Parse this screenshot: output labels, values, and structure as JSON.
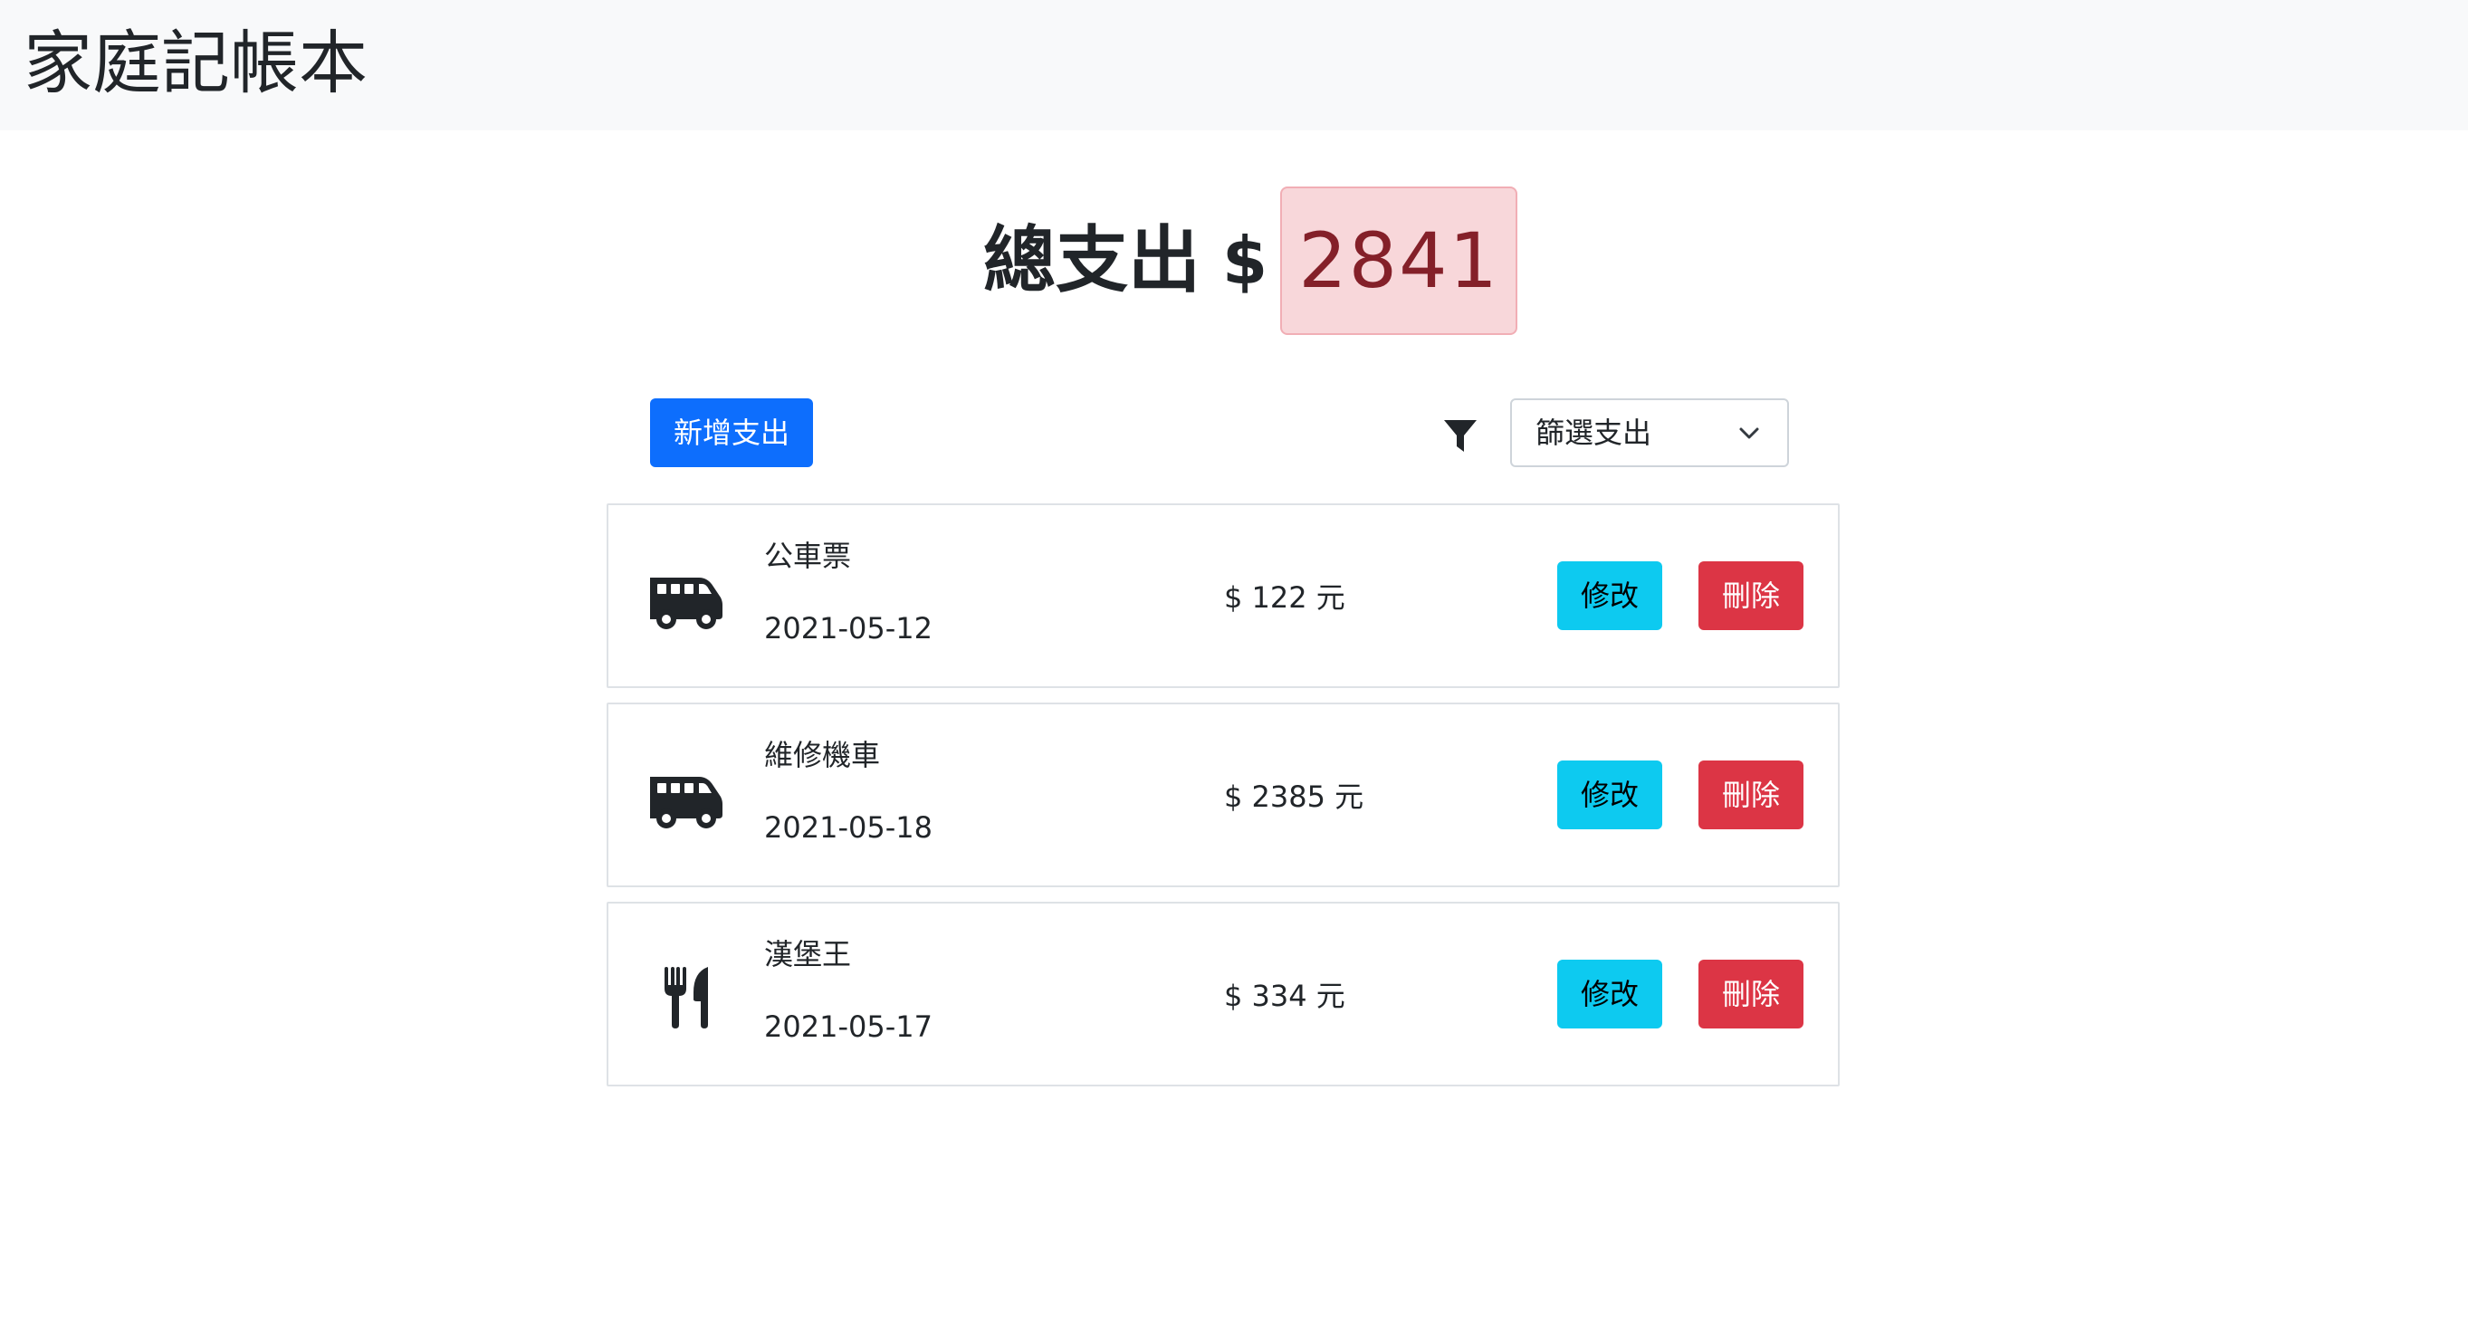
{
  "app": {
    "title": "家庭記帳本"
  },
  "summary": {
    "label": "總支出",
    "currency": "$",
    "total": "2841"
  },
  "toolbar": {
    "add_label": "新增支出",
    "filter_icon": "filter-icon",
    "filter_selected": "篩選支出"
  },
  "expenses": [
    {
      "icon": "van-icon",
      "name": "公車票",
      "date": "2021-05-12",
      "amount": "$ 122 元",
      "edit_label": "修改",
      "delete_label": "刪除"
    },
    {
      "icon": "van-icon",
      "name": "維修機車",
      "date": "2021-05-18",
      "amount": "$ 2385 元",
      "edit_label": "修改",
      "delete_label": "刪除"
    },
    {
      "icon": "utensils-icon",
      "name": "漢堡王",
      "date": "2021-05-17",
      "amount": "$ 334 元",
      "edit_label": "修改",
      "delete_label": "刪除"
    }
  ],
  "colors": {
    "navbar_bg": "#f8f9fa",
    "primary": "#0d6efd",
    "info": "#0dcaf0",
    "danger": "#dc3545",
    "total_bg": "#f8d7da",
    "total_text": "#842029"
  }
}
